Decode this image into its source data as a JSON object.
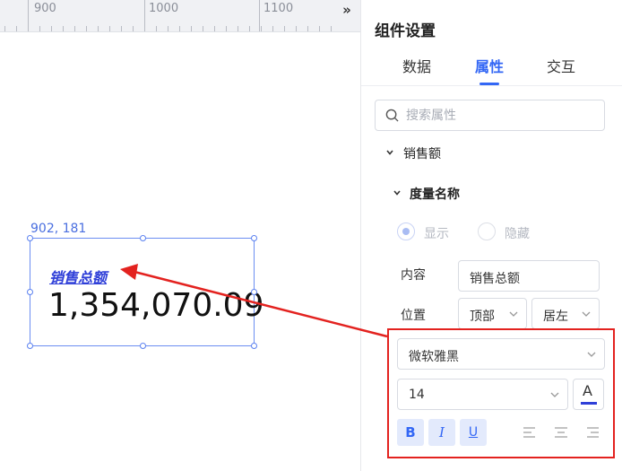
{
  "ruler": {
    "labels": [
      "900",
      "1000",
      "1100"
    ]
  },
  "canvas": {
    "coord_label": "902, 181",
    "widget": {
      "title": "销售总额",
      "value": "1,354,070.09"
    }
  },
  "panel": {
    "title": "组件设置",
    "tabs": [
      {
        "label": "数据",
        "active": false
      },
      {
        "label": "属性",
        "active": true
      },
      {
        "label": "交互",
        "active": false
      }
    ],
    "search": {
      "placeholder": "搜索属性",
      "value": ""
    },
    "section": "销售额",
    "subsection": "度量名称",
    "visibility": {
      "show_label": "显示",
      "hide_label": "隐藏",
      "selected": "显示"
    },
    "content": {
      "label": "内容",
      "value": "销售总额"
    },
    "position": {
      "label": "位置",
      "vertical": "顶部",
      "horizontal": "居左"
    },
    "font": {
      "family": "微软雅黑",
      "size": "14",
      "color": "#2f3fd8"
    },
    "format": {
      "bold": "B",
      "italic": "I",
      "underline": "U",
      "color_glyph": "A"
    }
  },
  "colors": {
    "accent": "#3367f5",
    "highlight": "#e3221f"
  }
}
